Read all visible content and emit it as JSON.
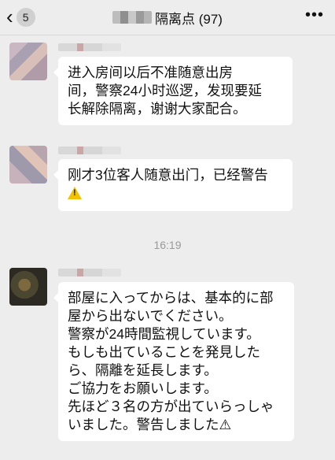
{
  "header": {
    "back_count": "5",
    "title": "隔离点 (97)",
    "more_label": "•••"
  },
  "messages": [
    {
      "lines": [
        "进入房间以后不准随意出房",
        "间，警察24小时巡逻，发现要延",
        "长解除隔离，谢谢大家配合。"
      ]
    },
    {
      "lines": [
        "刚才3位客人随意出门，已经警告"
      ],
      "icon": "warning-icon"
    },
    {
      "lines": [
        "部屋に入ってからは、基本的に部",
        "屋から出ないでください。",
        "警察が24時間監視しています。",
        "もしも出ていることを発見した",
        "ら、隔離を延長します。",
        "ご協力をお願いします。",
        "先ほど３名の方が出ていらっしゃ",
        "いました。警告しました⚠"
      ]
    }
  ],
  "timestamp": "16:19",
  "colors": {
    "background": "#ededed",
    "bubble": "#ffffff",
    "warning": "#f2c200"
  }
}
